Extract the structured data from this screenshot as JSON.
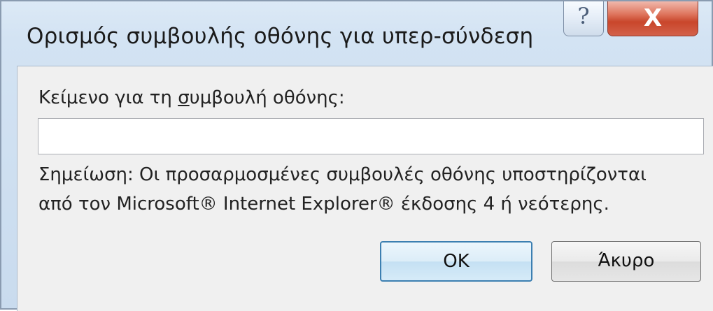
{
  "dialog": {
    "title": "Ορισμός συμβουλής οθόνης για υπερ-σύνδεση",
    "help_glyph": "?",
    "close_glyph": "X"
  },
  "form": {
    "label_prefix": "Κείμενο για τη ",
    "label_accel": "σ",
    "label_suffix": "υμβουλή οθόνης:",
    "input_value": "",
    "note_line1": "Σημείωση: Οι προσαρμοσμένες συμβουλές οθόνης υποστηρίζονται",
    "note_line2": "από τον Microsoft® Internet Explorer® έκδοσης 4 ή νεότερης."
  },
  "buttons": {
    "ok_label": "OK",
    "cancel_label": "Άκυρο"
  }
}
